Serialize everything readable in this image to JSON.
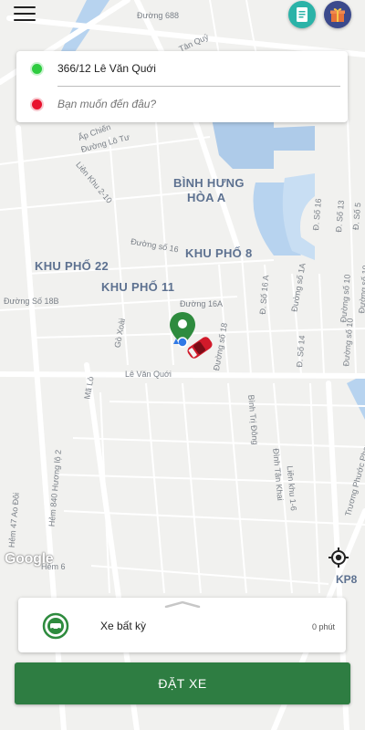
{
  "address": {
    "pickup": "366/12 Lê Văn Quới",
    "destination_placeholder": "Bạn muốn đến đâu?"
  },
  "map": {
    "areas": [
      "BÌNH HƯNG",
      "HÒA A",
      "KHU PHỐ 8",
      "KHU PHỐ 22",
      "KHU PHỐ 11",
      "KP8"
    ],
    "streets": {
      "s1": "Đường 688",
      "s2": "Tân Quý",
      "s3": "Ấp Chiến",
      "s4": "Đường Lô Tư",
      "s5": "Liên Khu 2-10",
      "s6": "Đường số 16",
      "s7": "Đường Số 18B",
      "s8": "Đường 16A",
      "s9": "Gò Xoài",
      "s10": "Đường số 18",
      "s11": "Lê Văn Quới",
      "s12": "Mã Lò",
      "s13": "Bình Trị Đông",
      "s14": "Đ. Số 14",
      "s15": "Đường số 10",
      "s16": "Liên khu 1-6",
      "s17": "Đình Tân Khai",
      "s18": "Trương Phước Phan",
      "s19": "Hẻm 47 Ao Đôi",
      "s20": "Hẻm 840 Hương lộ 2",
      "s21": "Đ. Số 16 A",
      "s22": "Đ. Số 16",
      "s23": "Đ. Số 13",
      "s24": "Đ. Số 5",
      "s25": "Đường số 10",
      "s26": "Hẻm 6",
      "s27": "Đường số 1A",
      "s28": "Đường số 10"
    },
    "provider": "Google"
  },
  "vehicle": {
    "name": "Xe bất kỳ",
    "eta": "0 phút"
  },
  "book_button": "ĐẶT XE",
  "colors": {
    "primary": "#2e7d42",
    "pickup_dot": "#2ecc40",
    "dest_dot": "#e8112d",
    "pin": "#2e8b3e",
    "car": "#d11a2a"
  },
  "icons": [
    "menu-icon",
    "document-icon",
    "gift-icon",
    "location-pin-icon",
    "car-icon",
    "locate-icon",
    "vehicle-logo-icon"
  ]
}
